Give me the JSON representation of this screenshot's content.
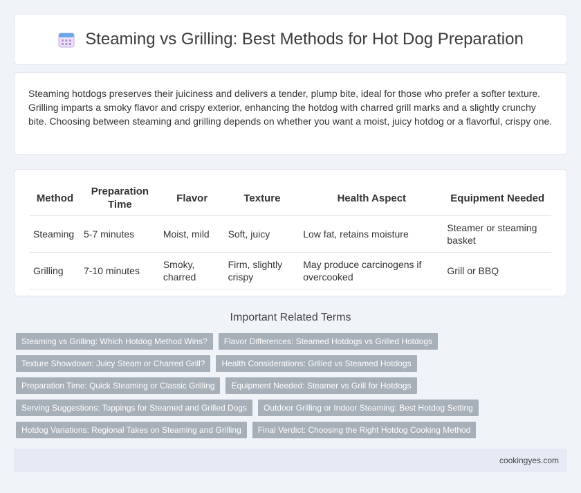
{
  "header": {
    "title": "Steaming vs Grilling: Best Methods for Hot Dog Preparation",
    "icon": "calendar-icon"
  },
  "intro": {
    "text": "Steaming hotdogs preserves their juiciness and delivers a tender, plump bite, ideal for those who prefer a softer texture. Grilling imparts a smoky flavor and crispy exterior, enhancing the hotdog with charred grill marks and a slightly crunchy bite. Choosing between steaming and grilling depends on whether you want a moist, juicy hotdog or a flavorful, crispy one."
  },
  "table": {
    "headers": [
      "Method",
      "Preparation Time",
      "Flavor",
      "Texture",
      "Health Aspect",
      "Equipment Needed"
    ],
    "rows": [
      [
        "Steaming",
        "5-7 minutes",
        "Moist, mild",
        "Soft, juicy",
        "Low fat, retains moisture",
        "Steamer or steaming basket"
      ],
      [
        "Grilling",
        "7-10 minutes",
        "Smoky, charred",
        "Firm, slightly crispy",
        "May produce carcinogens if overcooked",
        "Grill or BBQ"
      ]
    ]
  },
  "related": {
    "title": "Important Related Terms",
    "tags": [
      [
        "Steaming vs Grilling: Which Hotdog Method Wins?",
        "Flavor Differences: Steamed Hotdogs vs Grilled Hotdogs"
      ],
      [
        "Texture Showdown: Juicy Steam or Charred Grill?",
        "Health Considerations: Grilled vs Steamed Hotdogs"
      ],
      [
        "Preparation Time: Quick Steaming or Classic Grilling",
        "Equipment Needed: Steamer vs Grill for Hotdogs"
      ],
      [
        "Serving Suggestions: Toppings for Steamed and Grilled Dogs",
        "Outdoor Grilling or Indoor Steaming: Best Hotdog Setting"
      ],
      [
        "Hotdog Variations: Regional Takes on Steaming and Grilling",
        "Final Verdict: Choosing the Right Hotdog Cooking Method"
      ]
    ]
  },
  "footer": {
    "site": "cookingyes.com"
  },
  "colors": {
    "background": "#f0f3f8",
    "tag": "#a7afb9",
    "footer": "#e5eaf4"
  }
}
